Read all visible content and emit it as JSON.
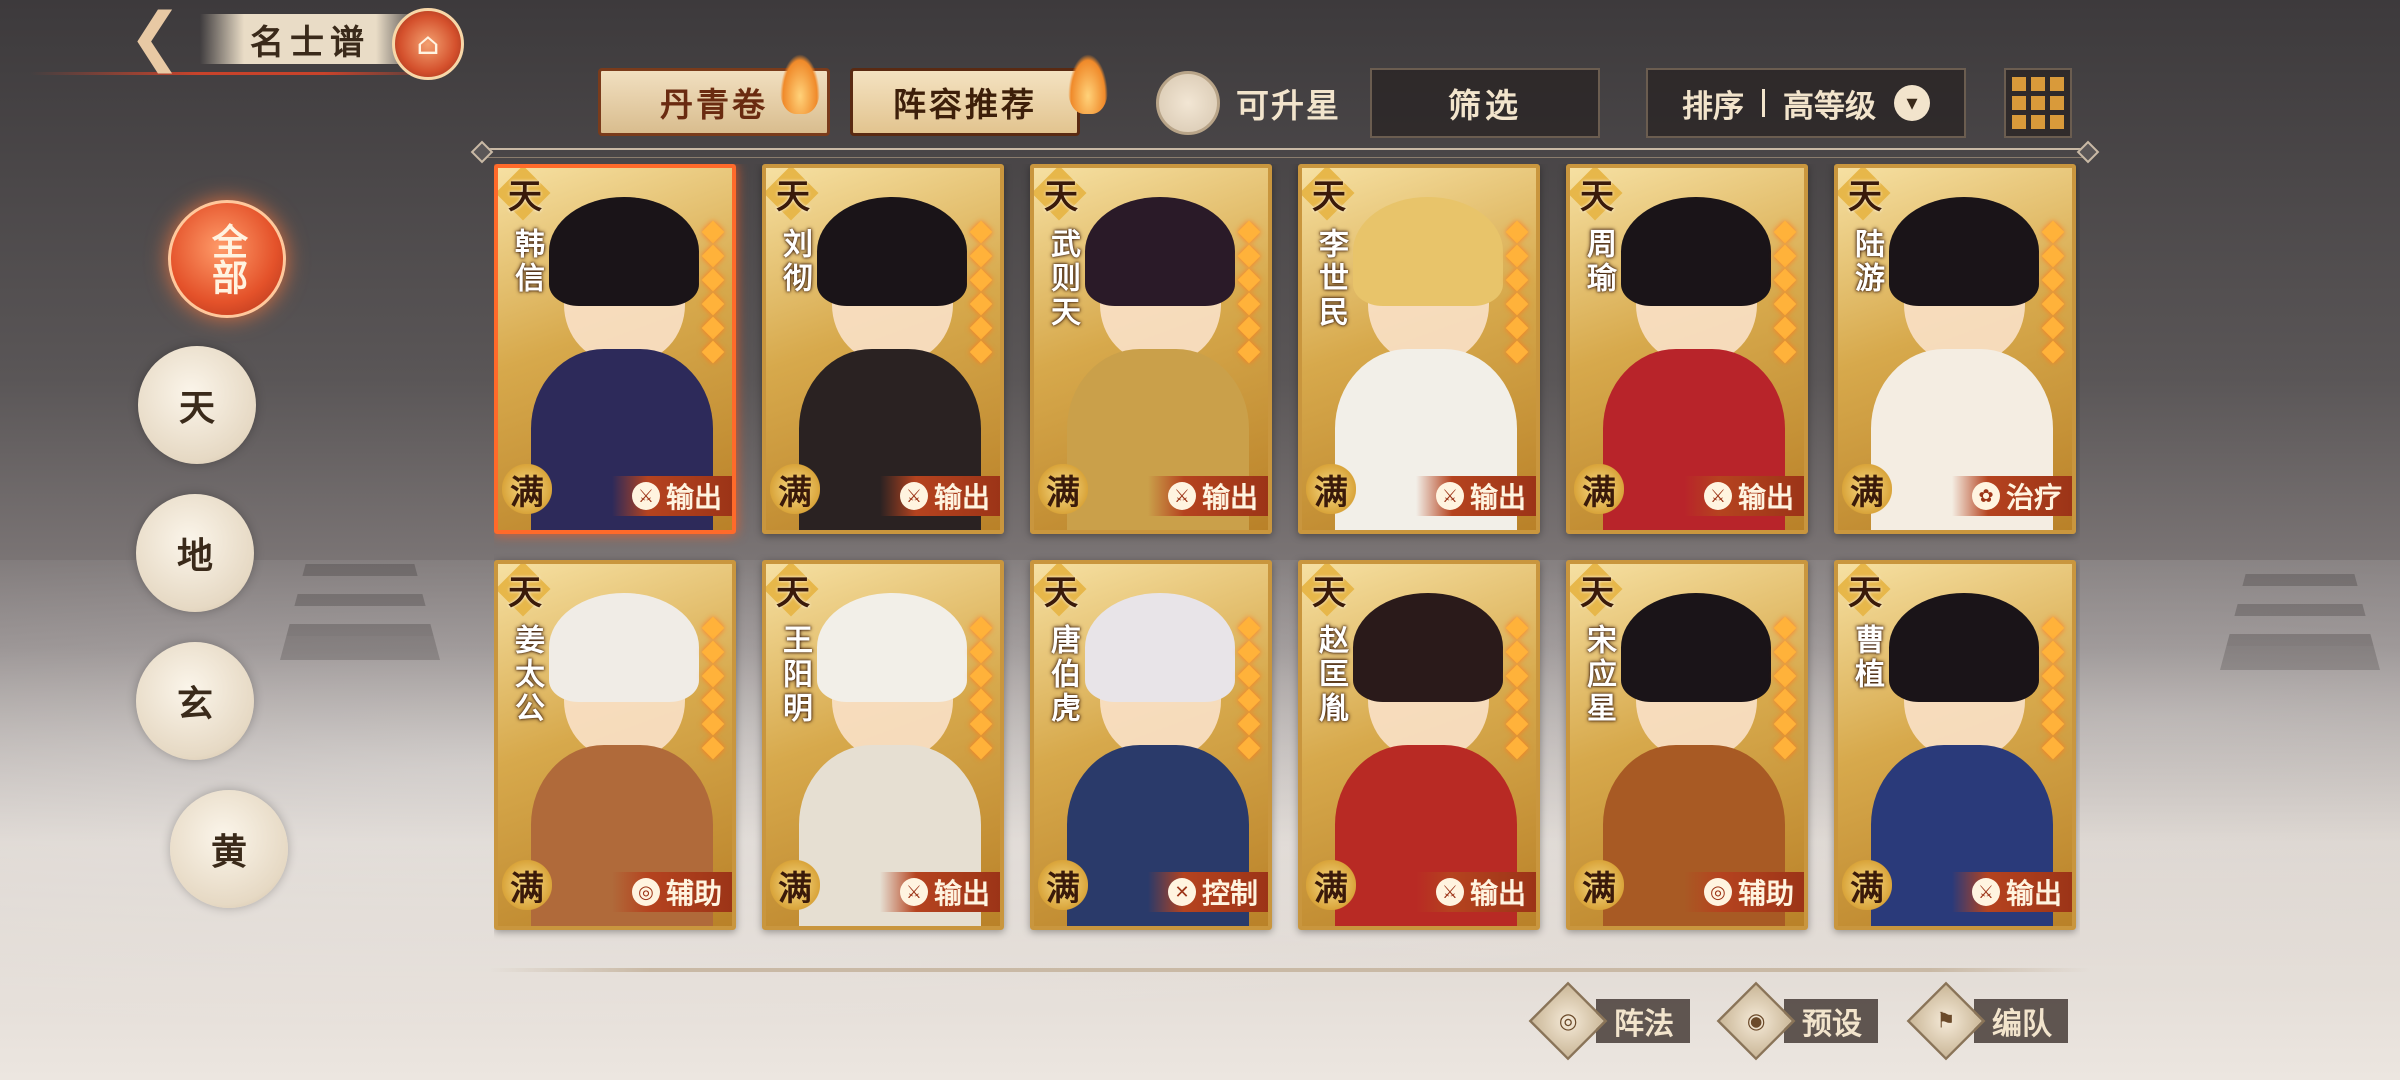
{
  "header": {
    "back_icon": "back-arrow-icon",
    "title": "名士谱",
    "emblem_icon": "pavilion-emblem-icon"
  },
  "tabs": [
    {
      "label": "丹青卷",
      "active": false
    },
    {
      "label": "阵容推荐",
      "active": true
    }
  ],
  "toolbar": {
    "upgrade_label": "可升星",
    "filter_label": "筛选",
    "sort_label": "排序",
    "sort_value": "高等级",
    "grid_icon": "grid-view-icon"
  },
  "rank_filters": [
    {
      "label": "全部",
      "active": true
    },
    {
      "label": "天",
      "active": false
    },
    {
      "label": "地",
      "active": false
    },
    {
      "label": "玄",
      "active": false
    },
    {
      "label": "黄",
      "active": false
    }
  ],
  "cards": [
    {
      "name": "韩信",
      "rank": "天",
      "man": "满",
      "role": "输出",
      "role_icon": "sword",
      "robe": "#2d2a5a",
      "hair": "#1a1418",
      "selected": true
    },
    {
      "name": "刘彻",
      "rank": "天",
      "man": "满",
      "role": "输出",
      "role_icon": "sword",
      "robe": "#2a2222",
      "hair": "#1a1418"
    },
    {
      "name": "武则天",
      "rank": "天",
      "man": "满",
      "role": "输出",
      "role_icon": "sword",
      "robe": "#caa04a",
      "hair": "#2a1a28"
    },
    {
      "name": "李世民",
      "rank": "天",
      "man": "满",
      "role": "输出",
      "role_icon": "sword",
      "robe": "#f2efe8",
      "hair": "#e8c46a"
    },
    {
      "name": "周瑜",
      "rank": "天",
      "man": "满",
      "role": "输出",
      "role_icon": "sword",
      "robe": "#b8242a",
      "hair": "#1a1418"
    },
    {
      "name": "陆游",
      "rank": "天",
      "man": "满",
      "role": "治疗",
      "role_icon": "leaf",
      "robe": "#f4ede2",
      "hair": "#1a1418"
    },
    {
      "name": "姜太公",
      "rank": "天",
      "man": "满",
      "role": "辅助",
      "role_icon": "swirl",
      "robe": "#b06a3a",
      "hair": "#f0ece6"
    },
    {
      "name": "王阳明",
      "rank": "天",
      "man": "满",
      "role": "输出",
      "role_icon": "sword",
      "robe": "#e6dfd2",
      "hair": "#f2efe8"
    },
    {
      "name": "唐伯虎",
      "rank": "天",
      "man": "满",
      "role": "控制",
      "role_icon": "cross",
      "robe": "#2a3a6a",
      "hair": "#e8e4e8"
    },
    {
      "name": "赵匡胤",
      "rank": "天",
      "man": "满",
      "role": "输出",
      "role_icon": "sword",
      "robe": "#b82a24",
      "hair": "#2a1a1a"
    },
    {
      "name": "宋应星",
      "rank": "天",
      "man": "满",
      "role": "辅助",
      "role_icon": "swirl",
      "robe": "#a85a24",
      "hair": "#1a1418"
    },
    {
      "name": "曹植",
      "rank": "天",
      "man": "满",
      "role": "输出",
      "role_icon": "sword",
      "robe": "#2a3a7a",
      "hair": "#1a1418"
    }
  ],
  "actions": [
    {
      "label": "阵法",
      "icon": "formation-icon"
    },
    {
      "label": "预设",
      "icon": "preset-icon"
    },
    {
      "label": "编队",
      "icon": "team-icon"
    }
  ]
}
